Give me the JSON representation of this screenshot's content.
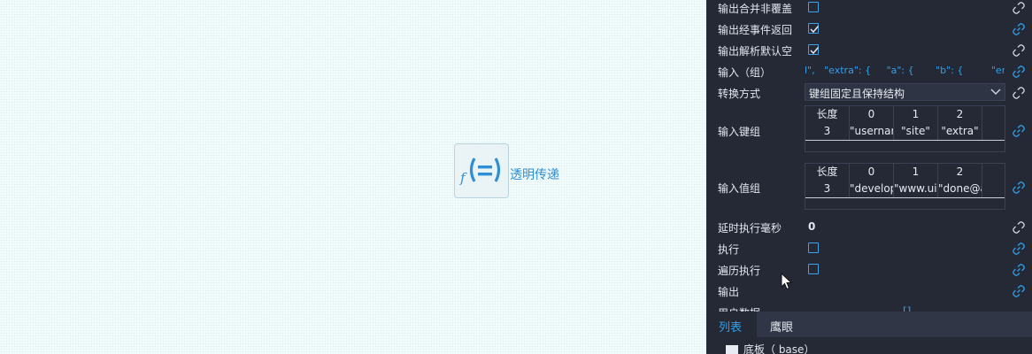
{
  "node": {
    "icon": "function-equals-icon",
    "label": "透明传递"
  },
  "panel": {
    "rows": {
      "merge": {
        "label": "输出合并非覆盖",
        "checked": false
      },
      "event_return": {
        "label": "输出经事件返回",
        "checked": true
      },
      "parse_default": {
        "label": "输出解析默认空",
        "checked": true
      },
      "inputs": {
        "label": "输入（组）",
        "value": "l\",   \"extra\": {     \"a\": {       \"b\": {         \"email\""
      },
      "convert_mode": {
        "label": "转换方式",
        "value": "键组固定且保持结构"
      },
      "key_group": {
        "label": "输入键组",
        "headers": [
          "长度",
          "0",
          "1",
          "2"
        ],
        "values": [
          "3",
          "\"username\"",
          "\"site\"",
          "\"extra\""
        ]
      },
      "value_group": {
        "label": "输入值组",
        "headers": [
          "长度",
          "0",
          "1",
          "2"
        ],
        "values": [
          "3",
          "\"developer\"",
          "\"www.uiotos.net\"",
          "\"done@aiotos.com\""
        ]
      },
      "delay": {
        "label": "延时执行毫秒",
        "value": "0"
      },
      "execute": {
        "label": "执行",
        "checked": false
      },
      "iterate": {
        "label": "遍历执行",
        "checked": false
      },
      "output": {
        "label": "输出"
      },
      "user_data": {
        "label": "用户数据",
        "value": "[]"
      }
    },
    "tabs": [
      {
        "label": "列表",
        "active": true
      },
      {
        "label": "鹰眼",
        "active": false
      }
    ],
    "tree_item": "底板（ base）",
    "colors": {
      "accent": "#2fa1ea",
      "panel_bg": "#252936",
      "canvas_bg": "#f1fbfb"
    }
  }
}
